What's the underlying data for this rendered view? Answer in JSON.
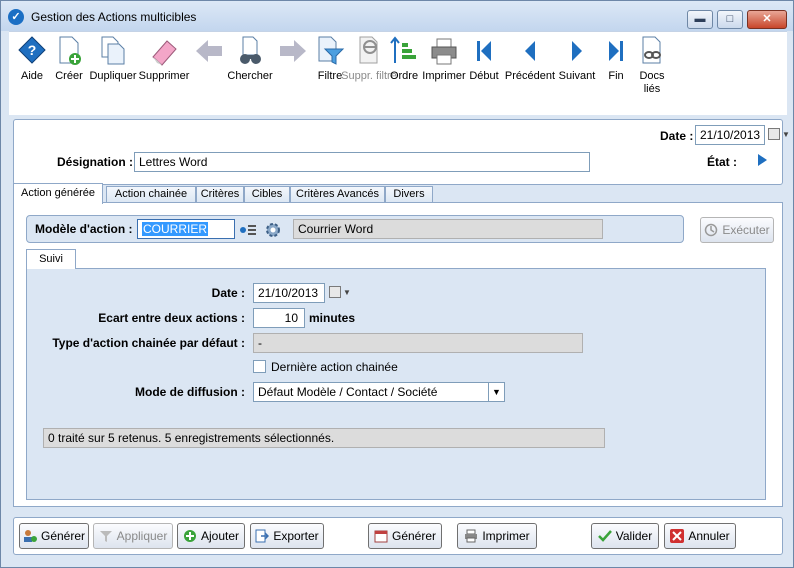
{
  "window": {
    "title": "Gestion des Actions multicibles",
    "minimize_glyph": "▬",
    "maximize_glyph": "□",
    "close_glyph": "✕"
  },
  "toolbar": {
    "items": [
      {
        "label": "Aide",
        "icon": "help-icon"
      },
      {
        "label": "Créer",
        "icon": "create-icon"
      },
      {
        "label": "Dupliquer",
        "icon": "duplicate-icon"
      },
      {
        "label": "Supprimer",
        "icon": "eraser-icon"
      },
      {
        "label": "Chercher",
        "icon": "binoculars-icon"
      },
      {
        "label": "Filtre",
        "icon": "filter-icon"
      },
      {
        "label": "Suppr. filtre",
        "icon": "remove-filter-icon",
        "disabled": true
      },
      {
        "label": "Ordre",
        "icon": "sort-icon"
      },
      {
        "label": "Imprimer",
        "icon": "printer-icon"
      },
      {
        "label": "Début",
        "icon": "first-icon"
      },
      {
        "label": "Précédent",
        "icon": "previous-icon"
      },
      {
        "label": "Suivant",
        "icon": "next-icon"
      },
      {
        "label": "Fin",
        "icon": "last-icon"
      },
      {
        "label": "Docs liés",
        "icon": "linked-docs-icon"
      }
    ]
  },
  "header": {
    "date_label": "Date :",
    "date_value": "21/10/2013",
    "designation_label": "Désignation :",
    "designation_value": "Lettres Word",
    "etat_label": "État :"
  },
  "tabs": [
    {
      "label": "Action générée",
      "active": true
    },
    {
      "label": "Action chainée"
    },
    {
      "label": "Critères"
    },
    {
      "label": "Cibles"
    },
    {
      "label": "Critères Avancés"
    },
    {
      "label": "Divers"
    }
  ],
  "model": {
    "label": "Modèle d'action :",
    "code": "COURRIER",
    "name": "Courrier Word",
    "execute_label": "Exécuter"
  },
  "suivi": {
    "tab_label": "Suivi",
    "date_label": "Date :",
    "date_value": "21/10/2013",
    "ecart_label": "Ecart entre deux actions :",
    "ecart_value": "10",
    "ecart_unit": "minutes",
    "type_label": "Type d'action chainée par défaut :",
    "type_value": "-",
    "derniere_label": "Dernière action chainée",
    "mode_label": "Mode de diffusion :",
    "mode_value": "Défaut Modèle / Contact / Société",
    "status_text": "0 traité sur 5 retenus. 5 enregistrements sélectionnés."
  },
  "bottom": {
    "generer1": "Générer",
    "appliquer": "Appliquer",
    "ajouter": "Ajouter",
    "exporter": "Exporter",
    "generer2": "Générer",
    "imprimer": "Imprimer",
    "valider": "Valider",
    "annuler": "Annuler"
  }
}
